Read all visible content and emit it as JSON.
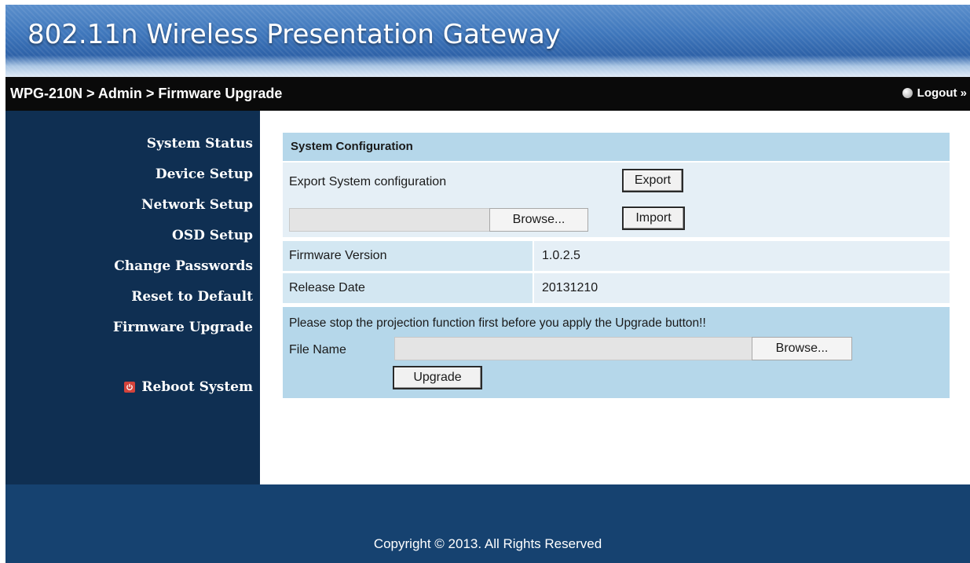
{
  "header": {
    "title": "802.11n Wireless Presentation Gateway"
  },
  "bar": {
    "breadcrumb": "WPG-210N > Admin > Firmware Upgrade",
    "logout": "Logout »"
  },
  "sidebar": {
    "items": [
      {
        "label": "System Status"
      },
      {
        "label": "Device Setup"
      },
      {
        "label": "Network Setup"
      },
      {
        "label": "OSD Setup"
      },
      {
        "label": "Change Passwords"
      },
      {
        "label": "Reset to Default"
      },
      {
        "label": "Firmware Upgrade"
      }
    ],
    "reboot": "Reboot System"
  },
  "config": {
    "heading": "System Configuration",
    "export_label": "Export System configuration",
    "export_button": "Export",
    "browse_button": "Browse...",
    "import_button": "Import",
    "file_value": ""
  },
  "info": {
    "firmware_label": "Firmware Version",
    "firmware_value": "1.0.2.5",
    "release_label": "Release Date",
    "release_value": "20131210"
  },
  "upgrade": {
    "notice": "Please stop the projection function first before you apply the Upgrade button!!",
    "file_label": "File Name",
    "file_value": "",
    "browse_button": "Browse...",
    "upgrade_button": "Upgrade"
  },
  "footer": {
    "copyright": "Copyright © 2013. All Rights Reserved"
  },
  "colors": {
    "sidebar_bg": "#0f2f52",
    "footer_bg": "#164270",
    "section_header": "#b5d7ea",
    "section_body": "#e5eff6"
  },
  "icons": {
    "logout": "logout-dot-icon",
    "reboot": "power-icon"
  }
}
